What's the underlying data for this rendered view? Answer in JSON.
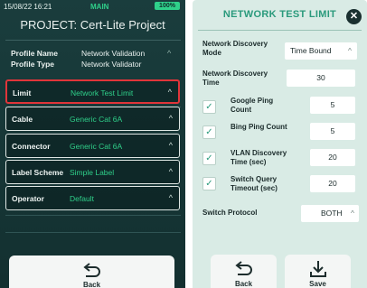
{
  "left": {
    "status": {
      "time": "15/08/22 16:21",
      "app": "MAIN",
      "battery": "100%"
    },
    "project_title": "PROJECT: Cert-Lite Project",
    "profile": {
      "name_label": "Profile Name",
      "name_value": "Network Validation",
      "type_label": "Profile Type",
      "type_value": "Network Validator"
    },
    "items": [
      {
        "label": "Limit",
        "value": "Network Test Limit"
      },
      {
        "label": "Cable",
        "value": "Generic Cat 6A"
      },
      {
        "label": "Connector",
        "value": "Generic Cat 6A"
      },
      {
        "label": "Label Scheme",
        "value": "Simple Label"
      },
      {
        "label": "Operator",
        "value": "Default"
      }
    ],
    "back_label": "Back"
  },
  "right": {
    "title": "NETWORK TEST LIMIT",
    "discovery_mode_label": "Network Discovery Mode",
    "discovery_mode_value": "Time Bound",
    "discovery_time_label": "Network Discovery Time",
    "discovery_time_value": "30",
    "google_label": "Google Ping Count",
    "google_value": "5",
    "google_checked": true,
    "bing_label": "Bing Ping Count",
    "bing_value": "5",
    "bing_checked": true,
    "vlan_label": "VLAN Discovery Time (sec)",
    "vlan_value": "20",
    "vlan_checked": true,
    "switch_query_label": "Switch Query Timeout (sec)",
    "switch_query_value": "20",
    "switch_query_checked": true,
    "switch_protocol_label": "Switch Protocol",
    "switch_protocol_value": "BOTH",
    "back_label": "Back",
    "save_label": "Save"
  }
}
